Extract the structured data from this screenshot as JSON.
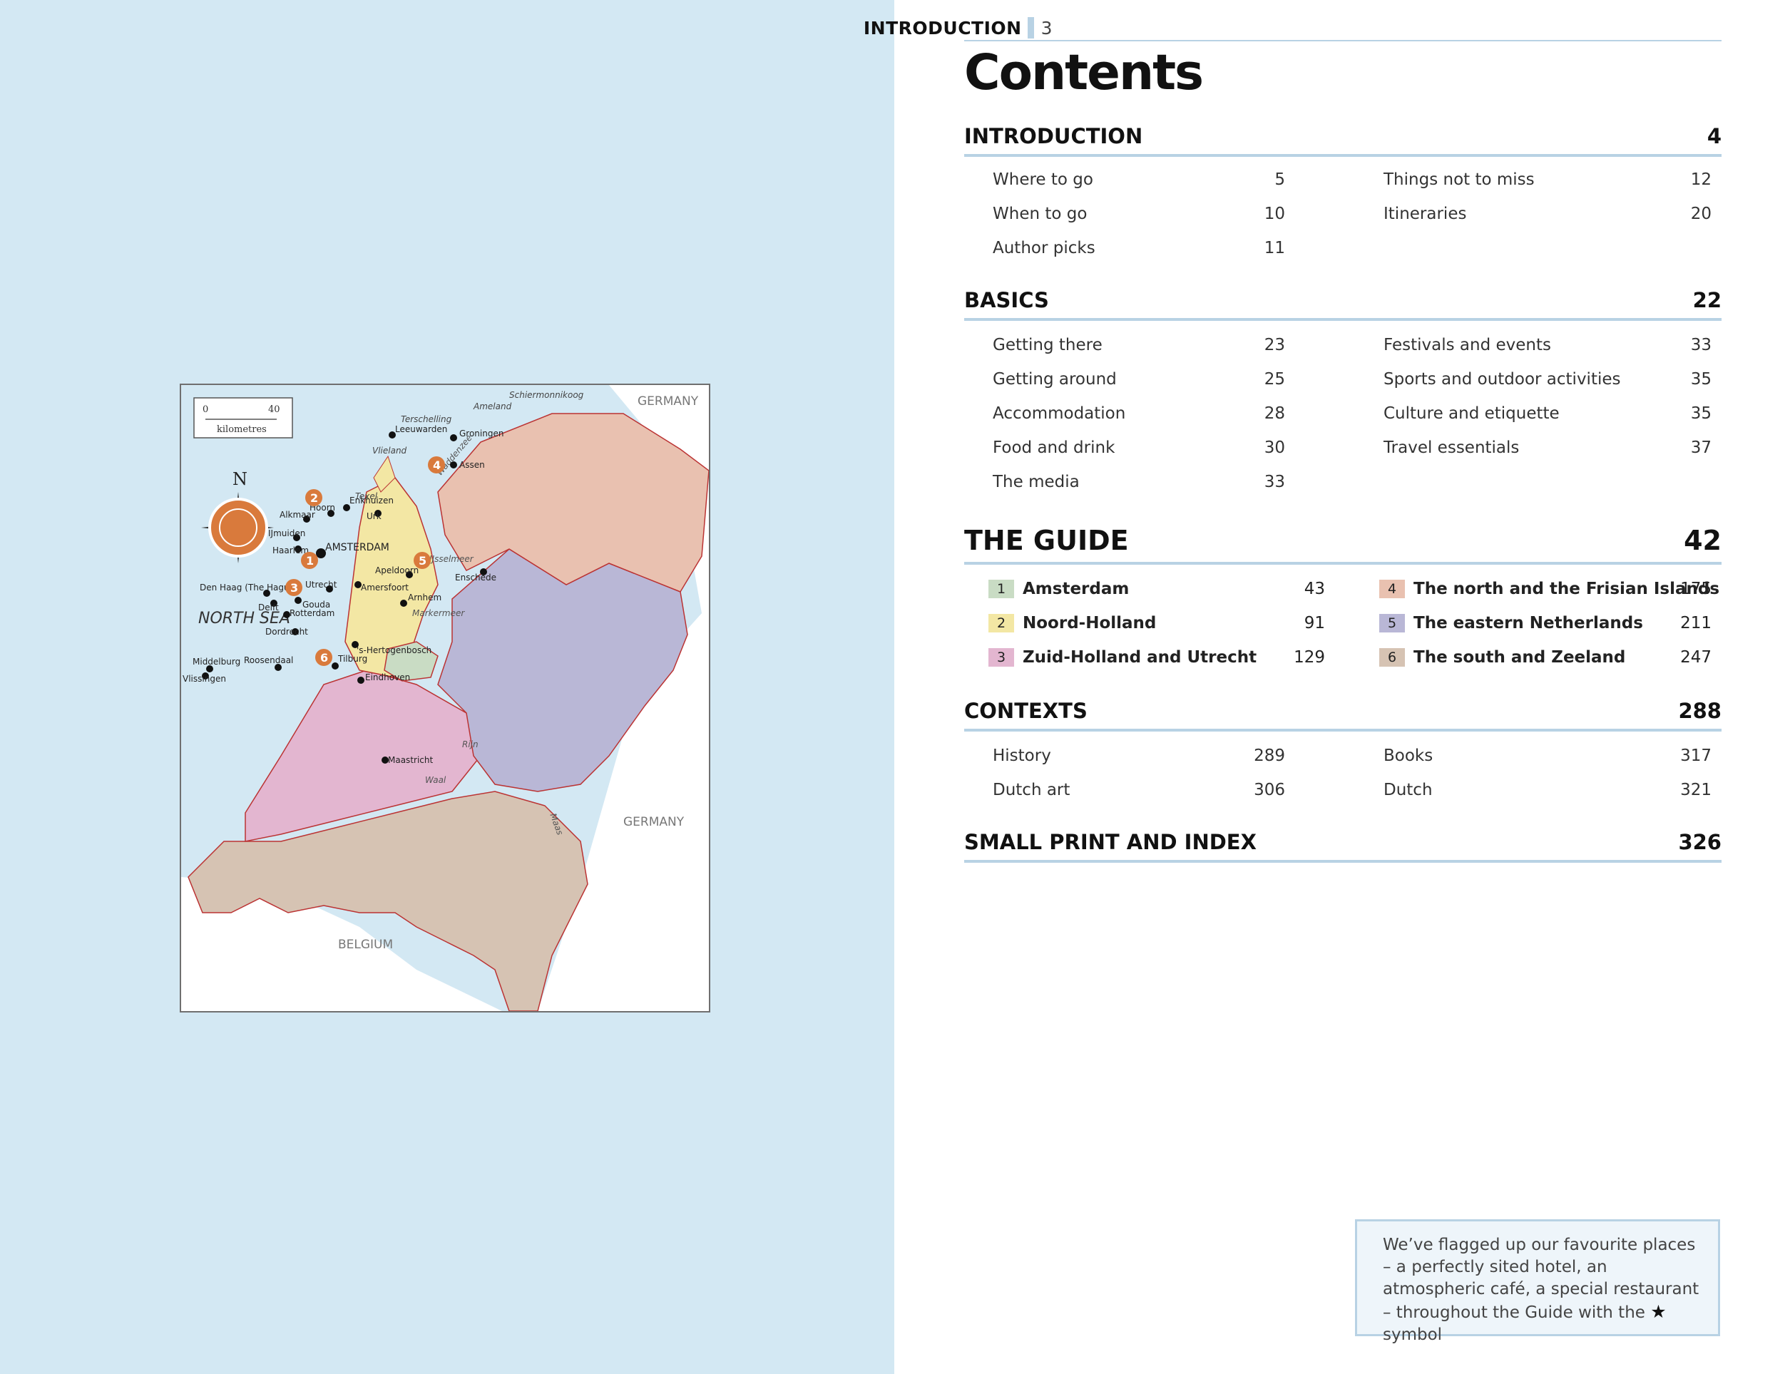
{
  "running_head": {
    "section": "INTRODUCTION",
    "page": "3"
  },
  "title": "Contents",
  "sections": {
    "introduction": {
      "title": "INTRODUCTION",
      "page": "4",
      "left": [
        {
          "label": "Where to go",
          "page": "5"
        },
        {
          "label": "When to go",
          "page": "10"
        },
        {
          "label": "Author picks",
          "page": "11"
        }
      ],
      "right": [
        {
          "label": "Things not to miss",
          "page": "12"
        },
        {
          "label": "Itineraries",
          "page": "20"
        }
      ]
    },
    "basics": {
      "title": "BASICS",
      "page": "22",
      "left": [
        {
          "label": "Getting there",
          "page": "23"
        },
        {
          "label": "Getting around",
          "page": "25"
        },
        {
          "label": "Accommodation",
          "page": "28"
        },
        {
          "label": "Food and drink",
          "page": "30"
        },
        {
          "label": "The media",
          "page": "33"
        }
      ],
      "right": [
        {
          "label": "Festivals and events",
          "page": "33"
        },
        {
          "label": "Sports and outdoor activities",
          "page": "35"
        },
        {
          "label": "Culture and etiquette",
          "page": "35"
        },
        {
          "label": "Travel essentials",
          "page": "37"
        }
      ]
    },
    "guide": {
      "title": "THE GUIDE",
      "page": "42",
      "left": [
        {
          "num": "1",
          "label": "Amsterdam",
          "page": "43",
          "color": "#c9dcc4"
        },
        {
          "num": "2",
          "label": "Noord-Holland",
          "page": "91",
          "color": "#f3e7a4"
        },
        {
          "num": "3",
          "label": "Zuid-Holland and Utrecht",
          "page": "129",
          "color": "#e3b6d0"
        }
      ],
      "right": [
        {
          "num": "4",
          "label": "The north and the Frisian Islands",
          "page": "175",
          "color": "#e9c1b0"
        },
        {
          "num": "5",
          "label": "The eastern Netherlands",
          "page": "211",
          "color": "#b9b7d6"
        },
        {
          "num": "6",
          "label": "The south and Zeeland",
          "page": "247",
          "color": "#d6c3b3"
        }
      ]
    },
    "contexts": {
      "title": "CONTEXTS",
      "page": "288",
      "left": [
        {
          "label": "History",
          "page": "289"
        },
        {
          "label": "Dutch art",
          "page": "306"
        }
      ],
      "right": [
        {
          "label": "Books",
          "page": "317"
        },
        {
          "label": "Dutch",
          "page": "321"
        }
      ]
    },
    "small_print": {
      "title": "SMALL PRINT AND INDEX",
      "page": "326"
    }
  },
  "note": {
    "text_before": "We’ve flagged up our favourite places – a perfectly sited hotel, an atmospheric café, a special restaurant – throughout the Guide with the",
    "text_after": "symbol",
    "star_icon": "star-icon"
  },
  "map": {
    "scale": {
      "min": "0",
      "max": "40",
      "unit": "kilometres"
    },
    "compass": "N",
    "sea": "NORTH SEA",
    "countries": [
      "GERMANY",
      "GERMANY",
      "BELGIUM"
    ],
    "islands": [
      "Schiermonnikoog",
      "Ameland",
      "Terschelling",
      "Vlieland",
      "Texel"
    ],
    "waters": [
      "Waddenzee",
      "IJsselmeer",
      "Markermeer",
      "Rijn",
      "Waal",
      "Maas"
    ],
    "cities": [
      "Leeuwarden",
      "Groningen",
      "Assen",
      "Enkhuizen",
      "Hoorn",
      "Alkmaar",
      "Urk",
      "IJmuiden",
      "Haarlem",
      "AMSTERDAM",
      "Apeldoorn",
      "Enschede",
      "Den Haag (The Hague)",
      "Utrecht",
      "Amersfoort",
      "Delft",
      "Gouda",
      "Rotterdam",
      "Arnhem",
      "Dordrecht",
      "'s-Hertogenbosch",
      "Middelburg",
      "Roosendaal",
      "Tilburg",
      "Vlissingen",
      "Eindhoven",
      "Maastricht"
    ],
    "region_markers": [
      "1",
      "2",
      "3",
      "4",
      "5",
      "6"
    ],
    "colors": {
      "sea": "#d3e8f3",
      "land_neighbour": "#ffffff",
      "amsterdam": "#c9dcc4",
      "noord_holland": "#f3e7a4",
      "zuid_holland": "#e3b6d0",
      "north": "#e9c1b0",
      "east": "#b9b7d6",
      "south": "#d6c3b3",
      "marker": "#d97a3c"
    }
  }
}
